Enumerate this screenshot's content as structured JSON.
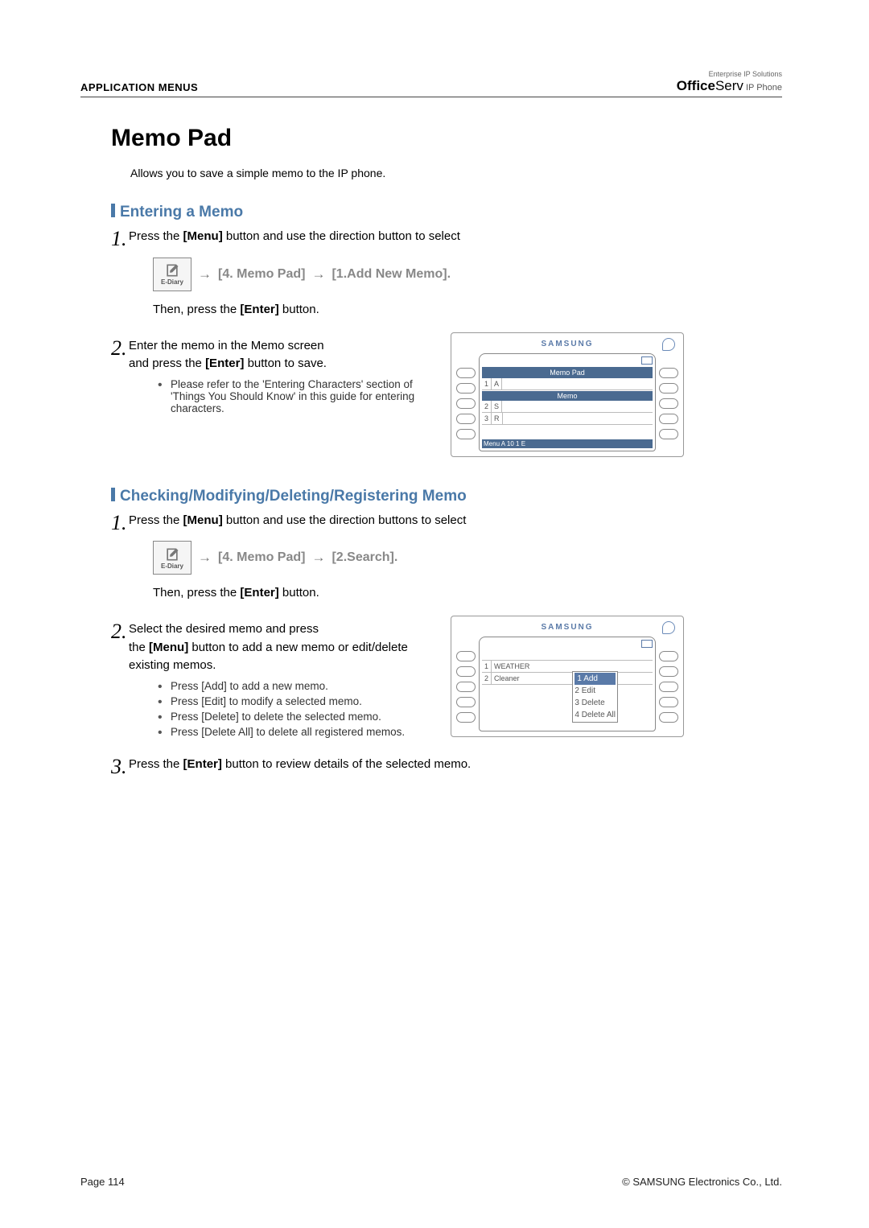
{
  "header": {
    "section": "APPLICATION MENUS",
    "brand_small": "Enterprise IP Solutions",
    "brand_office": "Office",
    "brand_serv": "Serv",
    "brand_ip": "IP Phone"
  },
  "title": "Memo Pad",
  "intro": "Allows you to save a simple memo to the IP phone.",
  "s1": {
    "heading": "Entering a Memo",
    "step1_a": "Press the ",
    "step1_b": "[Menu]",
    "step1_c": " button and use the direction button to select",
    "nav_a": "[4. Memo Pad]",
    "nav_b": "[1.Add New Memo].",
    "then_a": "Then, press the ",
    "then_b": "[Enter]",
    "then_c": " button.",
    "step2_a": "Enter the memo in the Memo screen",
    "step2_b": "and press the ",
    "step2_c": "[Enter]",
    "step2_d": " button to save.",
    "bullet1": "Please refer to the 'Entering Characters' section of 'Things You Should Know' in this guide for entering characters."
  },
  "phone1": {
    "brand": "SAMSUNG",
    "title": "Memo  Pad",
    "sub": "Memo",
    "row1a": "1",
    "row1b": "A",
    "row2a": "2",
    "row2b": "S",
    "row3a": "3",
    "row3b": "R",
    "status": "Menu  A  10  1  E"
  },
  "s2": {
    "heading": "Checking/Modifying/Deleting/Registering Memo",
    "step1_a": "Press the ",
    "step1_b": "[Menu]",
    "step1_c": " button and use the direction buttons to select",
    "nav_a": "[4. Memo Pad]",
    "nav_b": "[2.Search].",
    "then_a": "Then, press the ",
    "then_b": "[Enter]",
    "then_c": " button.",
    "step2_a": "Select the desired memo and press",
    "step2_b": "the ",
    "step2_c": "[Menu]",
    "step2_d": " button to add a new memo or edit/delete existing memos.",
    "b1": "Press [Add] to add a new memo.",
    "b2": "Press [Edit] to modify a selected memo.",
    "b3": "Press [Delete] to delete  the selected memo.",
    "b4": "Press [Delete All] to delete all registered memos.",
    "step3_a": "Press the ",
    "step3_b": "[Enter]",
    "step3_c": " button to review details of the selected memo."
  },
  "phone2": {
    "brand": "SAMSUNG",
    "row1n": "1",
    "row1t": "WEATHER",
    "row2n": "2",
    "row2t": "Cleaner",
    "pop1": "1  Add",
    "pop2": "2  Edit",
    "pop3": "3  Delete",
    "pop4": "4 Delete All"
  },
  "icon_label": "E-Diary",
  "footer": {
    "left": "Page 114",
    "right": "© SAMSUNG Electronics Co., Ltd."
  }
}
